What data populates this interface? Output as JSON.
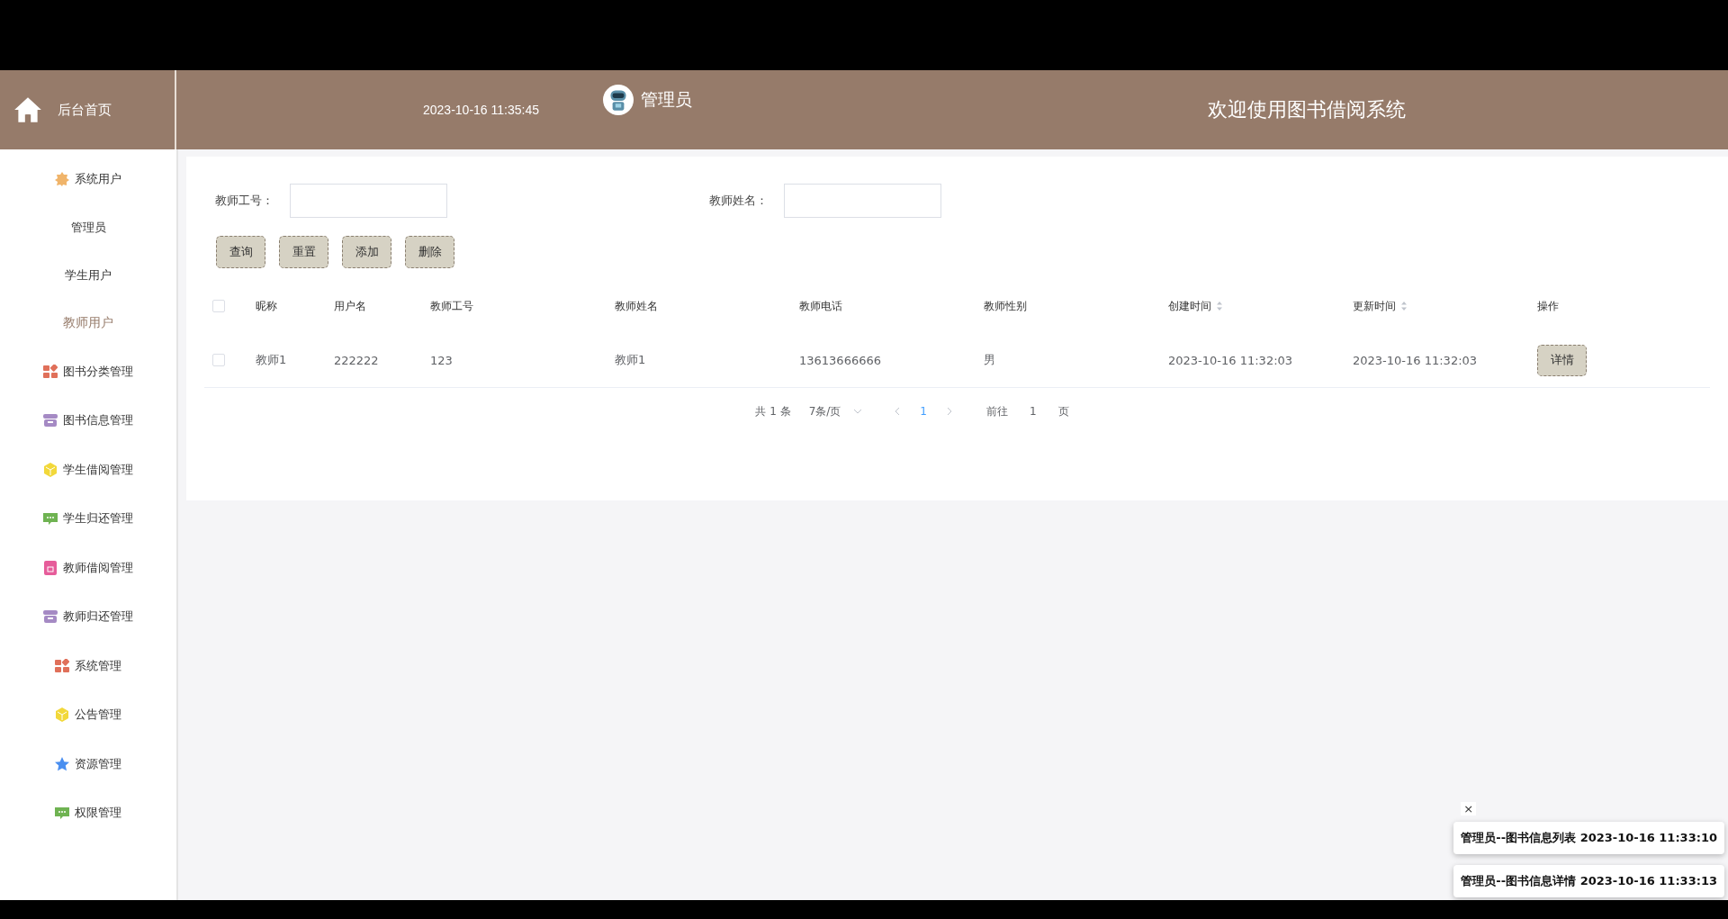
{
  "header": {
    "home_label": "后台首页",
    "datetime": "2023-10-16 11:35:45",
    "user": "管理员",
    "title": "欢迎使用图书借阅系统"
  },
  "sidebar": {
    "items": [
      {
        "label": "系统用户",
        "kind": "badge",
        "children": [
          {
            "label": "管理员",
            "selected": false
          },
          {
            "label": "学生用户",
            "selected": false
          },
          {
            "label": "教师用户",
            "selected": true
          }
        ]
      },
      {
        "label": "图书分类管理",
        "kind": "grid"
      },
      {
        "label": "图书信息管理",
        "kind": "archive"
      },
      {
        "label": "学生借阅管理",
        "kind": "cube"
      },
      {
        "label": "学生归还管理",
        "kind": "chat"
      },
      {
        "label": "教师借阅管理",
        "kind": "doc"
      },
      {
        "label": "教师归还管理",
        "kind": "archive"
      },
      {
        "label": "系统管理",
        "kind": "grid"
      },
      {
        "label": "公告管理",
        "kind": "cube"
      },
      {
        "label": "资源管理",
        "kind": "star"
      },
      {
        "label": "权限管理",
        "kind": "chat"
      }
    ]
  },
  "search": {
    "fields": [
      {
        "label": "教师工号："
      },
      {
        "label": "教师姓名："
      }
    ],
    "buttons": [
      "查询",
      "重置",
      "添加",
      "删除"
    ]
  },
  "table": {
    "all_checked": false,
    "columns": [
      {
        "label": "昵称",
        "sortable": false
      },
      {
        "label": "用户名",
        "sortable": false
      },
      {
        "label": "教师工号",
        "sortable": false
      },
      {
        "label": "教师姓名",
        "sortable": false
      },
      {
        "label": "教师电话",
        "sortable": false
      },
      {
        "label": "教师性别",
        "sortable": false
      },
      {
        "label": "创建时间",
        "sortable": true
      },
      {
        "label": "更新时间",
        "sortable": true
      },
      {
        "label": "操作",
        "sortable": false
      }
    ],
    "rows": [
      {
        "checked": false,
        "cells": [
          "教师1",
          "222222",
          "123",
          "教师1",
          "13613666666",
          "男",
          "2023-10-16 11:32:03",
          "2023-10-16 11:32:03"
        ],
        "action": "详情"
      }
    ]
  },
  "pagination": {
    "total": "共 1 条",
    "page_size": "7条/页",
    "pages": [
      {
        "label": "1",
        "selected": true
      }
    ],
    "goto_label": "前往",
    "goto_value": "1",
    "goto_suffix": "页"
  },
  "notifications": {
    "close": "×",
    "items": [
      "管理员--图书信息列表 2023-10-16 11:33:10",
      "管理员--图书信息详情 2023-10-16 11:33:13"
    ]
  }
}
